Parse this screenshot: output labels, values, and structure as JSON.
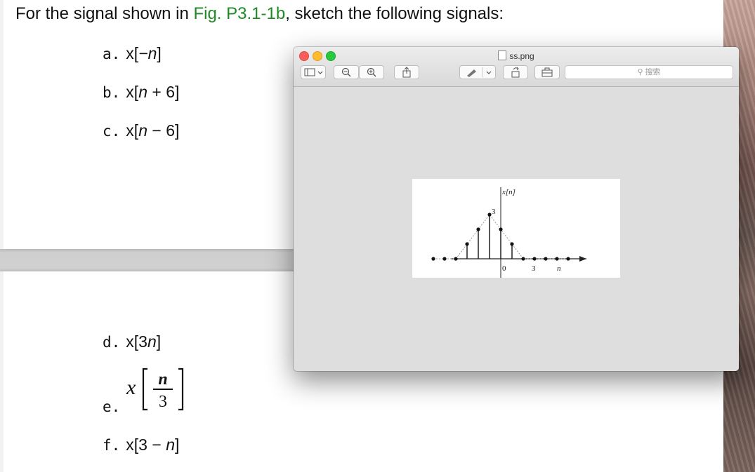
{
  "document": {
    "title_prefix": "For the signal shown in ",
    "title_fig": "Fig. P3.1-1b",
    "title_suffix": ", sketch the following signals:",
    "items": [
      {
        "label": "a.",
        "expr_pre": "x[",
        "var": "−n",
        "expr_post": "]"
      },
      {
        "label": "b.",
        "expr_pre": "x[",
        "var": "n",
        "expr_post": " + 6]"
      },
      {
        "label": "c.",
        "expr_pre": "x[",
        "var": "n",
        "expr_post": " − 6]"
      },
      {
        "label": "d.",
        "expr_pre": "x[3",
        "var": "n",
        "expr_post": "]"
      },
      {
        "label": "e.",
        "expr_x": "x",
        "frac_num": "n",
        "frac_den": "3"
      },
      {
        "label": "f.",
        "expr_pre": "x[3 − ",
        "var": "n",
        "expr_post": "]"
      }
    ]
  },
  "preview_window": {
    "title": "ss.png",
    "search_placeholder": "搜索",
    "figure": {
      "ylabel": "x[n]",
      "peak_label": "3",
      "xlabel": "n",
      "x_tick_labels": [
        "0",
        "3"
      ]
    }
  },
  "chart_data": {
    "type": "stem",
    "ylabel": "x[n]",
    "xlabel": "n",
    "x": [
      -6,
      -5,
      -4,
      -3,
      -2,
      -1,
      0,
      1,
      2,
      3,
      4,
      5,
      6
    ],
    "values": [
      0,
      0,
      0,
      1,
      2,
      3,
      2,
      1,
      0,
      0,
      0,
      0,
      0
    ],
    "x_ticks": [
      0,
      3
    ],
    "y_ticks": [
      3
    ]
  },
  "colors": {
    "figure_ref": "#1e8a26",
    "close": "#fc5f57",
    "minimize": "#fdbc2e",
    "maximize": "#28c840"
  }
}
